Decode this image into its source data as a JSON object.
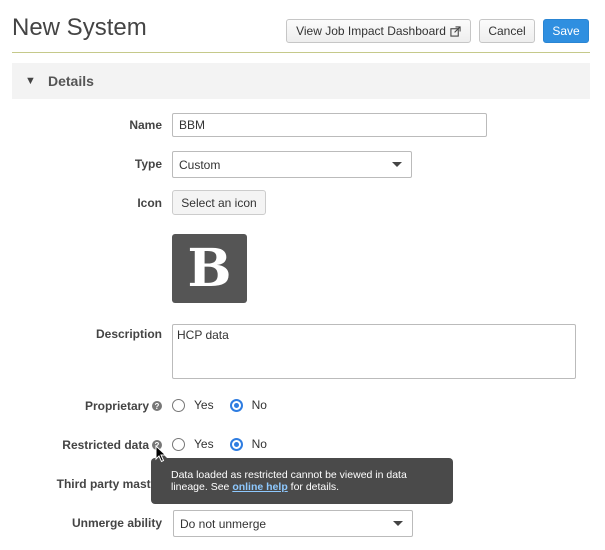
{
  "page": {
    "title": "New System"
  },
  "header": {
    "dashboard_label": "View Job Impact Dashboard",
    "cancel_label": "Cancel",
    "save_label": "Save"
  },
  "section": {
    "caret": "▼",
    "title": "Details"
  },
  "form": {
    "name": {
      "label": "Name",
      "value": "BBM"
    },
    "type": {
      "label": "Type",
      "value": "Custom"
    },
    "icon": {
      "label": "Icon",
      "button": "Select an icon",
      "preview_letter": "B"
    },
    "description": {
      "label": "Description",
      "value": "HCP data"
    },
    "proprietary": {
      "label": "Proprietary",
      "yes": "Yes",
      "no": "No",
      "selected": "No"
    },
    "restricted": {
      "label": "Restricted data",
      "yes": "Yes",
      "no": "No",
      "selected": "No"
    },
    "third_party": {
      "label": "Third party master"
    },
    "unmerge": {
      "label": "Unmerge ability",
      "value": "Do not unmerge"
    }
  },
  "tooltip": {
    "text_before": "Data loaded as restricted cannot be viewed in data lineage. See ",
    "link": "online help",
    "text_after": " for details."
  },
  "colors": {
    "primary": "#2f8fe0",
    "radio_checked": "#2f7de1",
    "tooltip_bg": "#4a4a4a"
  }
}
